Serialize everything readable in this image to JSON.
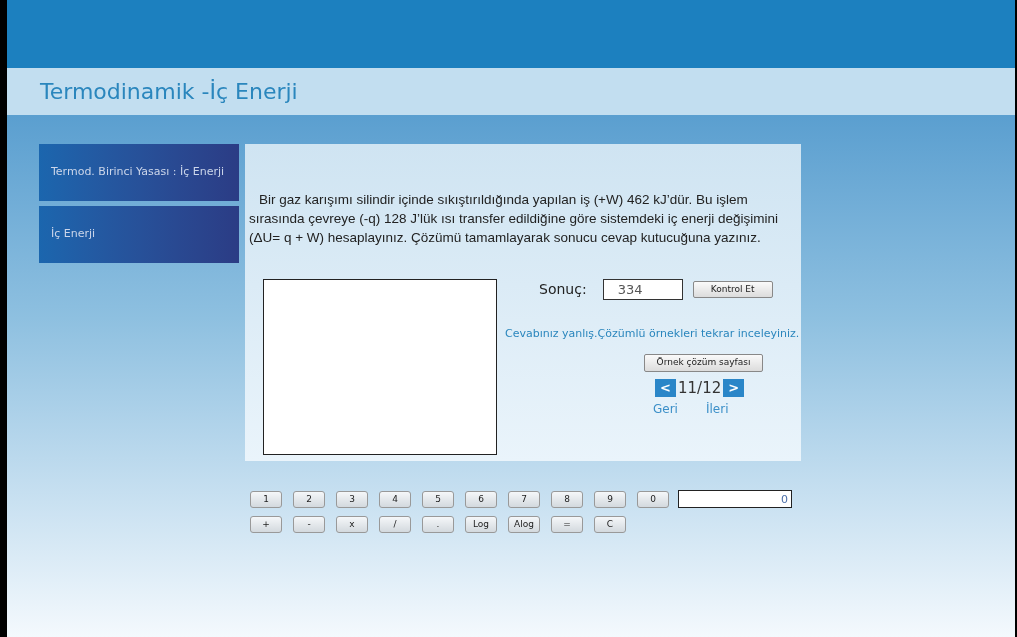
{
  "title": "Termodinamik -İç Enerji",
  "sidebar": {
    "items": [
      {
        "label": "Termod. Birinci Yasası : İç Enerji"
      },
      {
        "label": "İç Enerji"
      }
    ]
  },
  "question": "Bir gaz karışımı silindir içinde sıkıştırıldığında yapılan iş (+W) 462 kJ’dür. Bu işlem sırasında çevreye (-q) 128 J’lük ısı transfer edildiğine göre sistemdeki iç enerji değişimini (ΔU= q + W) hesaplayınız. Çözümü tamamlayarak sonucu cevap kutucuğuna yazınız.",
  "answer": {
    "label": "Sonuç:",
    "value": "334",
    "check_button": "Kontrol Et"
  },
  "feedback": "Cevabınız yanlış.Çözümlü örnekleri tekrar inceleyiniz.",
  "example_button": "Örnek çözüm sayfası",
  "pager": {
    "prev": "<",
    "next": ">",
    "page": "11/12",
    "prev_label": "Geri",
    "next_label": "İleri"
  },
  "calculator": {
    "rows": [
      [
        "1",
        "2",
        "3",
        "4",
        "5",
        "6",
        "7",
        "8",
        "9",
        "0"
      ],
      [
        "+",
        "-",
        "x",
        "/",
        ".",
        "Log",
        "Alog",
        "=",
        "C"
      ]
    ],
    "display": "0"
  }
}
